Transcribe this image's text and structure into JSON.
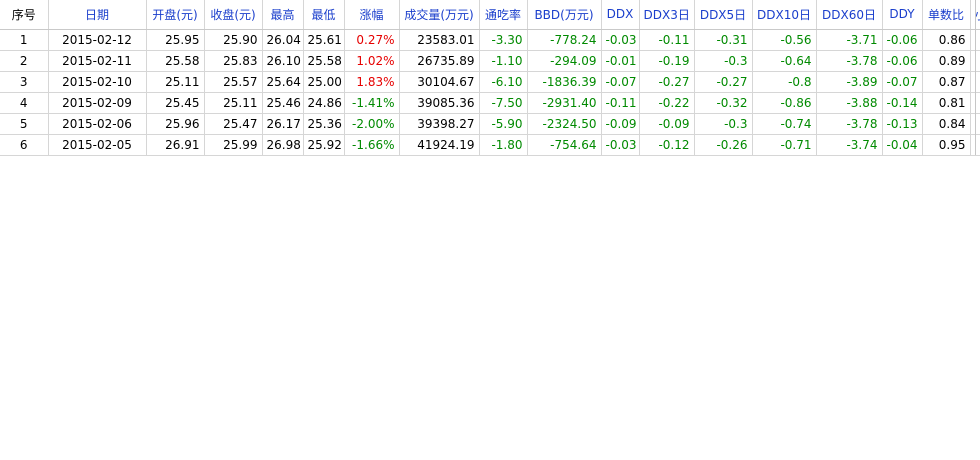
{
  "table": {
    "columns": [
      {
        "key": "idx",
        "label": "序号",
        "color": "#000000"
      },
      {
        "key": "date",
        "label": "日期",
        "color": "#1a3ecc"
      },
      {
        "key": "open",
        "label": "开盘(元)",
        "color": "#1a3ecc"
      },
      {
        "key": "close",
        "label": "收盘(元)",
        "color": "#1a3ecc"
      },
      {
        "key": "high",
        "label": "最高",
        "color": "#1a3ecc"
      },
      {
        "key": "low",
        "label": "最低",
        "color": "#1a3ecc"
      },
      {
        "key": "change",
        "label": "涨幅",
        "color": "#1a3ecc"
      },
      {
        "key": "volume",
        "label": "成交量(万元)",
        "color": "#1a3ecc"
      },
      {
        "key": "tunchi",
        "label": "通吃率",
        "color": "#1a3ecc"
      },
      {
        "key": "bbd",
        "label": "BBD(万元)",
        "color": "#1a3ecc"
      },
      {
        "key": "ddx",
        "label": "DDX",
        "color": "#1a3ecc"
      },
      {
        "key": "ddx3",
        "label": "DDX3日",
        "color": "#1a3ecc"
      },
      {
        "key": "ddx5",
        "label": "DDX5日",
        "color": "#1a3ecc"
      },
      {
        "key": "ddx10",
        "label": "DDX10日",
        "color": "#1a3ecc"
      },
      {
        "key": "ddx60",
        "label": "DDX60日",
        "color": "#1a3ecc"
      },
      {
        "key": "ddy",
        "label": "DDY",
        "color": "#1a3ecc"
      },
      {
        "key": "ratio",
        "label": "单数比",
        "color": "#1a3ecc"
      },
      {
        "key": "small",
        "label": "小",
        "color": "#1a3ecc"
      }
    ],
    "rows": [
      {
        "idx": "1",
        "date": "2015-02-12",
        "open": "25.95",
        "close": "25.90",
        "high": "26.04",
        "low": "25.61",
        "change": "0.27%",
        "volume": "23583.01",
        "tunchi": "-3.30",
        "bbd": "-778.24",
        "ddx": "-0.03",
        "ddx3": "-0.11",
        "ddx5": "-0.31",
        "ddx10": "-0.56",
        "ddx60": "-3.71",
        "ddy": "-0.06",
        "ratio": "0.86",
        "small": ""
      },
      {
        "idx": "2",
        "date": "2015-02-11",
        "open": "25.58",
        "close": "25.83",
        "high": "26.10",
        "low": "25.58",
        "change": "1.02%",
        "volume": "26735.89",
        "tunchi": "-1.10",
        "bbd": "-294.09",
        "ddx": "-0.01",
        "ddx3": "-0.19",
        "ddx5": "-0.3",
        "ddx10": "-0.64",
        "ddx60": "-3.78",
        "ddy": "-0.06",
        "ratio": "0.89",
        "small": ""
      },
      {
        "idx": "3",
        "date": "2015-02-10",
        "open": "25.11",
        "close": "25.57",
        "high": "25.64",
        "low": "25.00",
        "change": "1.83%",
        "volume": "30104.67",
        "tunchi": "-6.10",
        "bbd": "-1836.39",
        "ddx": "-0.07",
        "ddx3": "-0.27",
        "ddx5": "-0.27",
        "ddx10": "-0.8",
        "ddx60": "-3.89",
        "ddy": "-0.07",
        "ratio": "0.87",
        "small": ""
      },
      {
        "idx": "4",
        "date": "2015-02-09",
        "open": "25.45",
        "close": "25.11",
        "high": "25.46",
        "low": "24.86",
        "change": "-1.41%",
        "volume": "39085.36",
        "tunchi": "-7.50",
        "bbd": "-2931.40",
        "ddx": "-0.11",
        "ddx3": "-0.22",
        "ddx5": "-0.32",
        "ddx10": "-0.86",
        "ddx60": "-3.88",
        "ddy": "-0.14",
        "ratio": "0.81",
        "small": ""
      },
      {
        "idx": "5",
        "date": "2015-02-06",
        "open": "25.96",
        "close": "25.47",
        "high": "26.17",
        "low": "25.36",
        "change": "-2.00%",
        "volume": "39398.27",
        "tunchi": "-5.90",
        "bbd": "-2324.50",
        "ddx": "-0.09",
        "ddx3": "-0.09",
        "ddx5": "-0.3",
        "ddx10": "-0.74",
        "ddx60": "-3.78",
        "ddy": "-0.13",
        "ratio": "0.84",
        "small": ""
      },
      {
        "idx": "6",
        "date": "2015-02-05",
        "open": "26.91",
        "close": "25.99",
        "high": "26.98",
        "low": "25.92",
        "change": "-1.66%",
        "volume": "41924.19",
        "tunchi": "-1.80",
        "bbd": "-754.64",
        "ddx": "-0.03",
        "ddx3": "-0.12",
        "ddx5": "-0.26",
        "ddx10": "-0.71",
        "ddx60": "-3.74",
        "ddy": "-0.04",
        "ratio": "0.95",
        "small": ""
      }
    ]
  },
  "colors": {
    "positive": "#e60000",
    "negative": "#008a00",
    "header_text": "#1a3ecc",
    "grid_line": "#d6d6d6"
  }
}
